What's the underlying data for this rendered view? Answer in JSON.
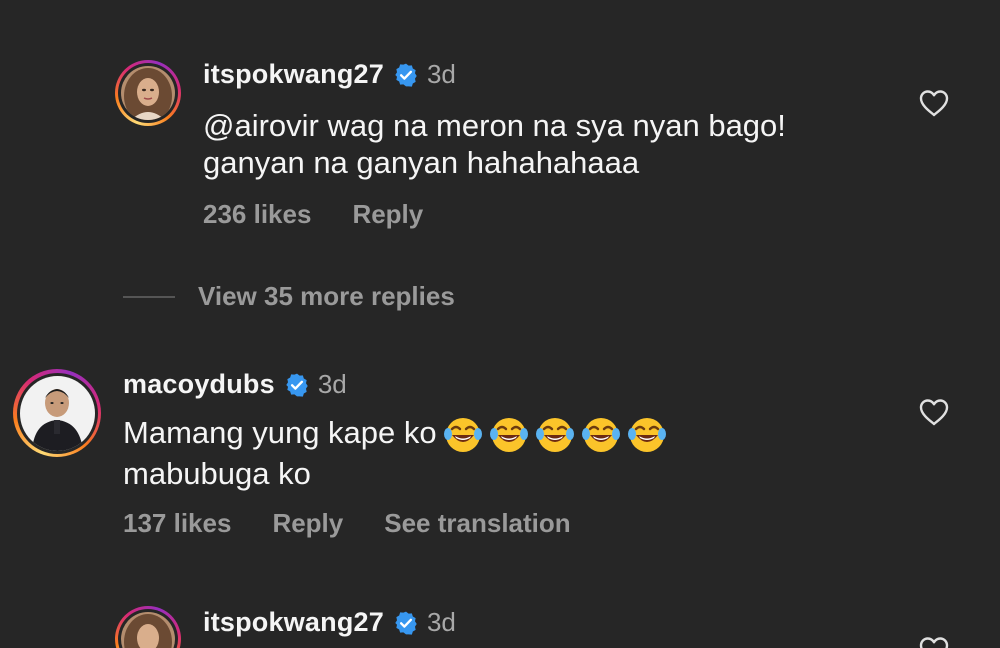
{
  "comments": [
    {
      "username": "itspokwang27",
      "verified": true,
      "time": "3d",
      "text_lines": [
        "@airovir wag na meron na sya nyan bago!",
        "ganyan na ganyan hahahahaaa"
      ],
      "likes": "236 likes",
      "reply": "Reply"
    },
    {
      "username": "macoydubs",
      "verified": true,
      "time": "3d",
      "text_lines": [
        "Mamang yung kape ko",
        "mabubuga ko"
      ],
      "emoji_count": 5,
      "emoji": "face-with-tears-of-joy",
      "likes": "137 likes",
      "reply": "Reply",
      "translate": "See translation"
    },
    {
      "username": "itspokwang27",
      "verified": true,
      "time": "3d"
    }
  ],
  "view_more_replies": "View 35 more replies",
  "colors": {
    "background": "#262626",
    "text": "#f5f5f5",
    "muted": "#9a9a9a",
    "verified_blue": "#3797f0"
  }
}
